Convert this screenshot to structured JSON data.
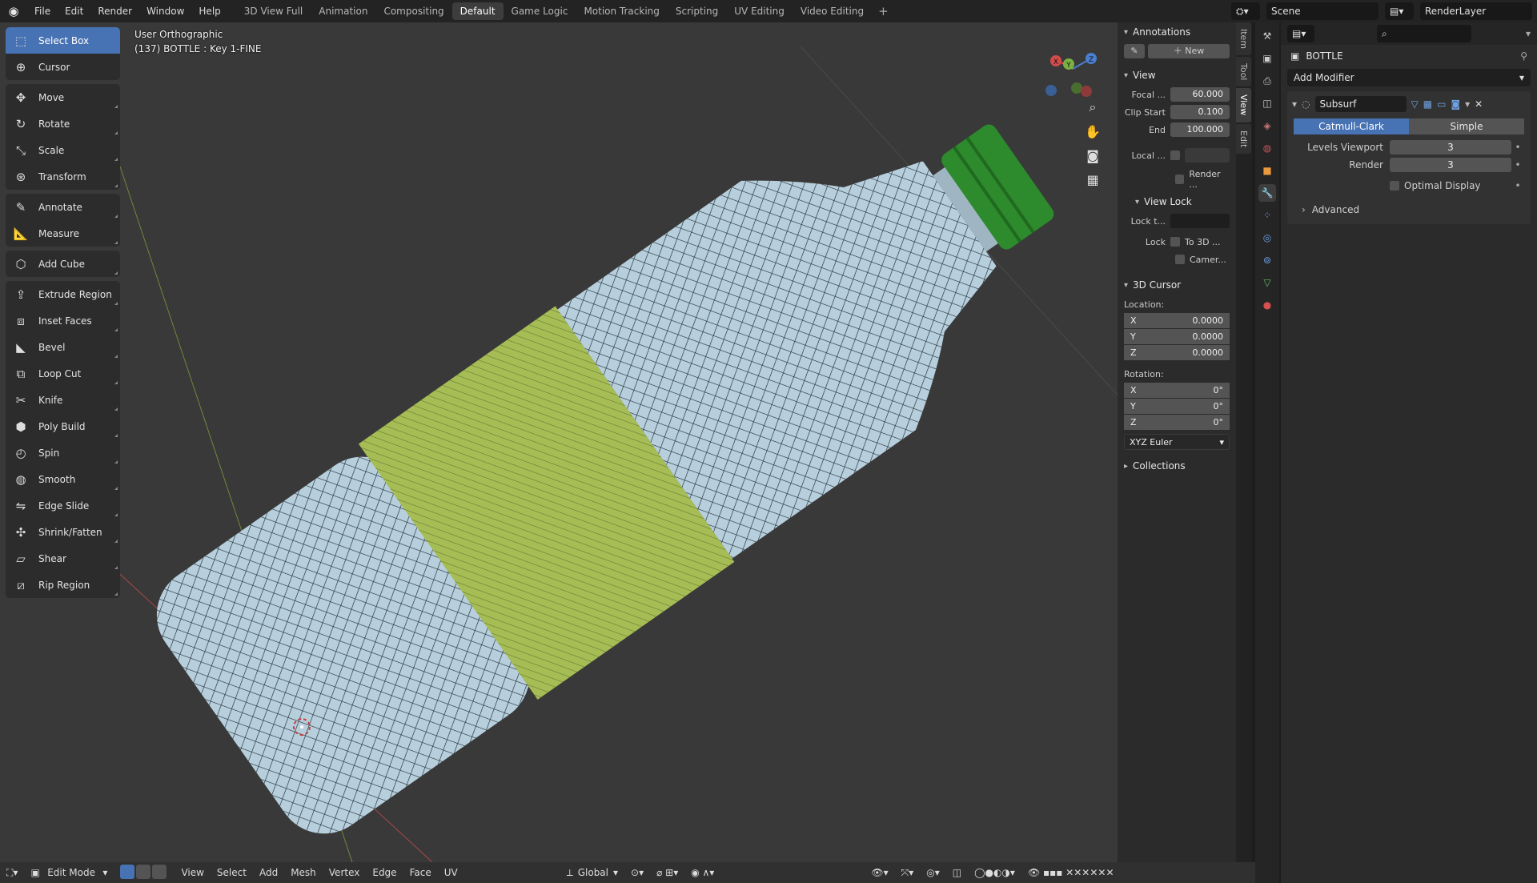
{
  "topbar": {
    "menu": [
      "File",
      "Edit",
      "Render",
      "Window",
      "Help"
    ],
    "workspaces": [
      "3D View Full",
      "Animation",
      "Compositing",
      "Default",
      "Game Logic",
      "Motion Tracking",
      "Scripting",
      "UV Editing",
      "Video Editing"
    ],
    "active_workspace": "Default",
    "add_tab": "+",
    "scene": "Scene",
    "render_layer": "RenderLayer"
  },
  "toolbar": {
    "groups": [
      [
        {
          "label": "Select Box",
          "icon": "select-box-icon",
          "active": true
        },
        {
          "label": "Cursor",
          "icon": "cursor-icon"
        }
      ],
      [
        {
          "label": "Move",
          "icon": "move-icon"
        },
        {
          "label": "Rotate",
          "icon": "rotate-icon"
        },
        {
          "label": "Scale",
          "icon": "scale-icon"
        },
        {
          "label": "Transform",
          "icon": "transform-icon"
        }
      ],
      [
        {
          "label": "Annotate",
          "icon": "annotate-icon"
        },
        {
          "label": "Measure",
          "icon": "measure-icon"
        }
      ],
      [
        {
          "label": "Add Cube",
          "icon": "add-cube-icon"
        }
      ],
      [
        {
          "label": "Extrude Region",
          "icon": "extrude-icon"
        },
        {
          "label": "Inset Faces",
          "icon": "inset-icon"
        },
        {
          "label": "Bevel",
          "icon": "bevel-icon"
        },
        {
          "label": "Loop Cut",
          "icon": "loop-cut-icon"
        },
        {
          "label": "Knife",
          "icon": "knife-icon"
        },
        {
          "label": "Poly Build",
          "icon": "poly-build-icon"
        },
        {
          "label": "Spin",
          "icon": "spin-icon"
        },
        {
          "label": "Smooth",
          "icon": "smooth-icon"
        },
        {
          "label": "Edge Slide",
          "icon": "edge-slide-icon"
        },
        {
          "label": "Shrink/Fatten",
          "icon": "shrink-fatten-icon"
        },
        {
          "label": "Shear",
          "icon": "shear-icon"
        },
        {
          "label": "Rip Region",
          "icon": "rip-region-icon"
        }
      ]
    ]
  },
  "viewport": {
    "view_name": "User Orthographic",
    "object_info": "(137) BOTTLE : Key 1-FINE",
    "gizmo": {
      "x": "X",
      "y": "Y",
      "z": "Z"
    }
  },
  "npanel": {
    "annotations": {
      "title": "Annotations",
      "new_label": "New"
    },
    "view": {
      "title": "View",
      "focal_label": "Focal ...",
      "focal": "60.000",
      "clip_start_label": "Clip Start",
      "clip_start": "0.100",
      "end_label": "End",
      "end": "100.000",
      "local_label": "Local ...",
      "render_label": "Render ..."
    },
    "view_lock": {
      "title": "View Lock",
      "lock_to_label": "Lock t...",
      "lock_label": "Lock",
      "to_3d": "To 3D ...",
      "camera": "Camer..."
    },
    "cursor": {
      "title": "3D Cursor",
      "location_label": "Location:",
      "loc": {
        "x": "0.0000",
        "y": "0.0000",
        "z": "0.0000"
      },
      "rotation_label": "Rotation:",
      "rot": {
        "x": "0°",
        "y": "0°",
        "z": "0°"
      },
      "mode": "XYZ Euler"
    },
    "collections": {
      "title": "Collections"
    },
    "tabs": [
      "Item",
      "Tool",
      "View",
      "Edit"
    ],
    "active_tab": "View"
  },
  "props": {
    "object_name": "BOTTLE",
    "add_modifier": "Add Modifier",
    "modifier": {
      "name": "Subsurf",
      "mode_a": "Catmull-Clark",
      "mode_b": "Simple",
      "levels_label": "Levels Viewport",
      "levels": "3",
      "render_label": "Render",
      "render": "3",
      "optimal_label": "Optimal Display",
      "advanced_label": "Advanced"
    }
  },
  "statusbar": {
    "mode": "Edit Mode",
    "menus": [
      "View",
      "Select",
      "Add",
      "Mesh",
      "Vertex",
      "Edge",
      "Face",
      "UV"
    ],
    "orientation": "Global"
  },
  "colors": {
    "accent": "#4772b3",
    "viewport_bg": "#393939",
    "bottle_body": "#b7cfdc",
    "label": "#a6bd55",
    "cap": "#2d8a2d"
  }
}
